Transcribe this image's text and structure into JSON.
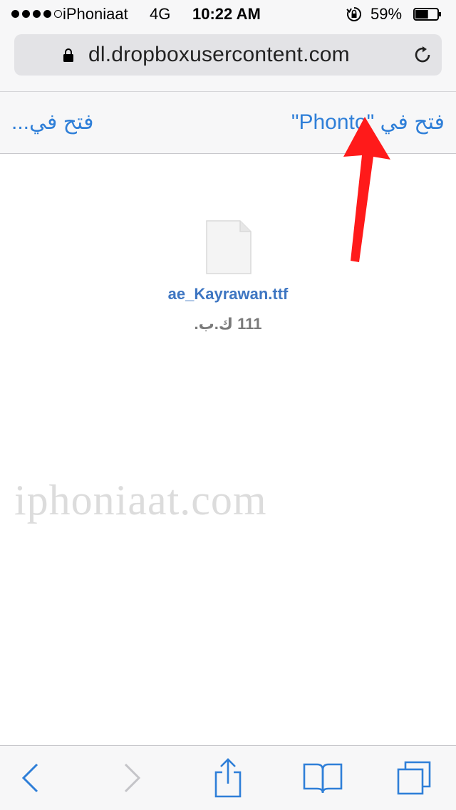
{
  "status_bar": {
    "carrier": "iPhoniaat",
    "network": "4G",
    "time": "10:22 AM",
    "battery_percent": "59%",
    "battery_level": 0.59,
    "signal_strength": 4
  },
  "address_bar": {
    "url": "dl.dropboxusercontent.com"
  },
  "open_bar": {
    "open_in_app_label": "فتح في \"Phonto\"",
    "open_in_more_label": "فتح في..."
  },
  "file": {
    "name": "ae_Kayrawan.ttf",
    "size": "111 ك.ب."
  },
  "watermark": "iphoniaat.com",
  "colors": {
    "link_blue": "#2f7fd8",
    "file_name_blue": "#3e76c2",
    "arrow_red": "#ff1a1a"
  },
  "icons": {
    "back": "chevron-left-icon",
    "forward": "chevron-right-icon",
    "share": "share-icon",
    "bookmarks": "book-icon",
    "tabs": "tabs-icon"
  }
}
